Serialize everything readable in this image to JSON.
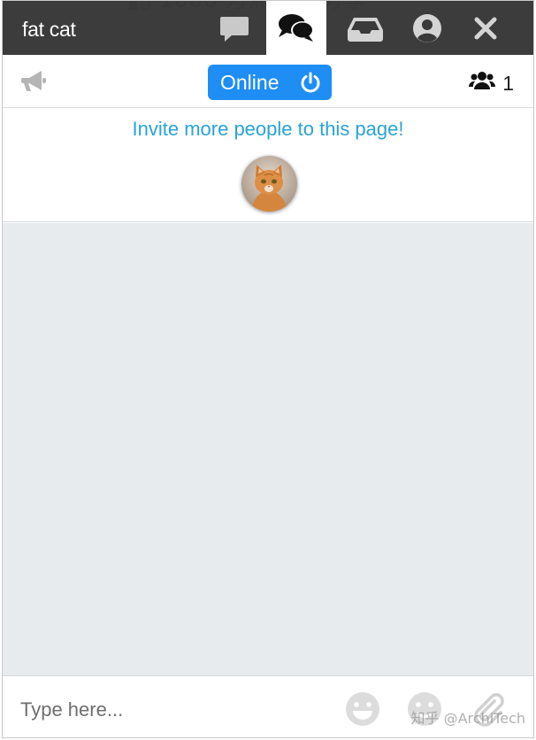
{
  "header": {
    "title": "fat cat",
    "icons": [
      "comment-icon",
      "comments-icon",
      "inbox-icon",
      "user-circle-icon",
      "close-icon"
    ],
    "active_icon": "comments-icon",
    "bg_color": "#343434"
  },
  "subbar": {
    "announce_icon": "bullhorn-icon",
    "status_label": "Online",
    "status_color": "#1e8ef4",
    "people_icon": "users-icon",
    "people_count": "1"
  },
  "invite": {
    "text": "Invite more people to this page!",
    "text_color": "#2aa3d8"
  },
  "messages": {
    "bg_color": "#e8ebee"
  },
  "composer": {
    "placeholder": "Type here...",
    "icons": [
      "grin-icon",
      "smile-icon",
      "paperclip-icon"
    ]
  },
  "watermark": "知乎 @ArchiTech"
}
